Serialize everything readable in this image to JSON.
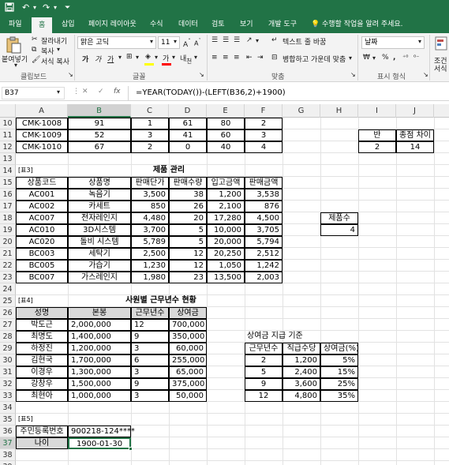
{
  "app": {
    "tabs": [
      "파일",
      "홈",
      "삽입",
      "페이지 레이아웃",
      "수식",
      "데이터",
      "검토",
      "보기",
      "개발 도구"
    ],
    "active_tab": "홈",
    "tell_me": "수행할 작업을 알려 주세요."
  },
  "ribbon": {
    "cut": "잘라내기",
    "copy": "복사",
    "format_painter": "서식 복사",
    "paste": "붙여넣기",
    "clipboard_group": "클립보드",
    "font_name": "맑은 고딕",
    "font_size": "11",
    "font_group": "글꼴",
    "wrap_text": "텍스트 줄 바꿈",
    "merge_center": "병합하고 가운데 맞춤",
    "align_group": "맞춤",
    "number_format": "날짜",
    "number_group": "표시 형식",
    "cond_format_1": "조건",
    "cond_format_2": "서식"
  },
  "formula_bar": {
    "name_box": "B37",
    "formula": "=YEAR(TODAY())-(LEFT(B36,2)+1900)"
  },
  "columns": [
    "A",
    "B",
    "C",
    "D",
    "E",
    "F",
    "G",
    "H",
    "I",
    "J"
  ],
  "selected_column": "B",
  "selected_row": "37",
  "rows": [
    "10",
    "11",
    "12",
    "13",
    "14",
    "15",
    "16",
    "17",
    "18",
    "19",
    "20",
    "21",
    "22",
    "23",
    "24",
    "25",
    "26",
    "27",
    "28",
    "29",
    "30",
    "31",
    "32",
    "33",
    "34",
    "35",
    "36",
    "37",
    "38",
    "39"
  ],
  "cells": {
    "top_rows": [
      [
        "CMK-1008",
        "91",
        "1",
        "61",
        "80",
        "2"
      ],
      [
        "CMK-1009",
        "52",
        "3",
        "41",
        "60",
        "3"
      ],
      [
        "CMK-1010",
        "67",
        "2",
        "0",
        "40",
        "4"
      ]
    ],
    "side_table": {
      "h1": "반",
      "h2": "종점 차이",
      "v1": "2",
      "v2": "14"
    },
    "t3_label": "[표3]",
    "t3_title": "제품 관리",
    "t3_headers": [
      "상품코드",
      "상품명",
      "판매단가",
      "판매수량",
      "입고금액",
      "판매금액"
    ],
    "t3_rows": [
      [
        "AC001",
        "녹음기",
        "3,500",
        "38",
        "1,200",
        "3,538"
      ],
      [
        "AC002",
        "카세트",
        "850",
        "26",
        "2,100",
        "876"
      ],
      [
        "AC007",
        "전자레인지",
        "4,480",
        "20",
        "17,280",
        "4,500"
      ],
      [
        "AC010",
        "3D시스템",
        "3,700",
        "5",
        "10,000",
        "3,705"
      ],
      [
        "AC020",
        "돌비 시스템",
        "5,789",
        "5",
        "20,000",
        "5,794"
      ],
      [
        "BC003",
        "세탁기",
        "2,500",
        "12",
        "20,250",
        "2,512"
      ],
      [
        "BC005",
        "가습기",
        "1,230",
        "12",
        "1,050",
        "1,242"
      ],
      [
        "BC007",
        "가스레인지",
        "1,980",
        "23",
        "13,500",
        "2,003"
      ]
    ],
    "product_count_label": "제품수",
    "product_count_value": "4",
    "t4_label": "[표4]",
    "t4_title": "사원별 근무년수 현황",
    "t4_headers": [
      "성명",
      "본봉",
      "근무년수",
      "상여금"
    ],
    "t4_rows": [
      [
        "박도근",
        "2,000,000",
        "12",
        "700,000"
      ],
      [
        "최명도",
        "1,400,000",
        "9",
        "350,000"
      ],
      [
        "하정진",
        "1,200,000",
        "3",
        "60,000"
      ],
      [
        "김현국",
        "1,700,000",
        "6",
        "255,000"
      ],
      [
        "이경우",
        "1,300,000",
        "3",
        "65,000"
      ],
      [
        "강창우",
        "1,500,000",
        "9",
        "375,000"
      ],
      [
        "최현아",
        "1,000,000",
        "3",
        "50,000"
      ]
    ],
    "bonus_title": "상여금 지급 기준",
    "bonus_headers": [
      "근무년수",
      "직급수당",
      "상여금(%)"
    ],
    "bonus_rows": [
      [
        "2",
        "1,200",
        "5%"
      ],
      [
        "5",
        "2,400",
        "15%"
      ],
      [
        "9",
        "3,600",
        "25%"
      ],
      [
        "12",
        "4,800",
        "35%"
      ]
    ],
    "t5_label": "[표5]",
    "t5_id_label": "주민등록번호",
    "t5_id_value": "900218-124****",
    "t5_age_label": "나이",
    "t5_age_value": "1900-01-30"
  }
}
